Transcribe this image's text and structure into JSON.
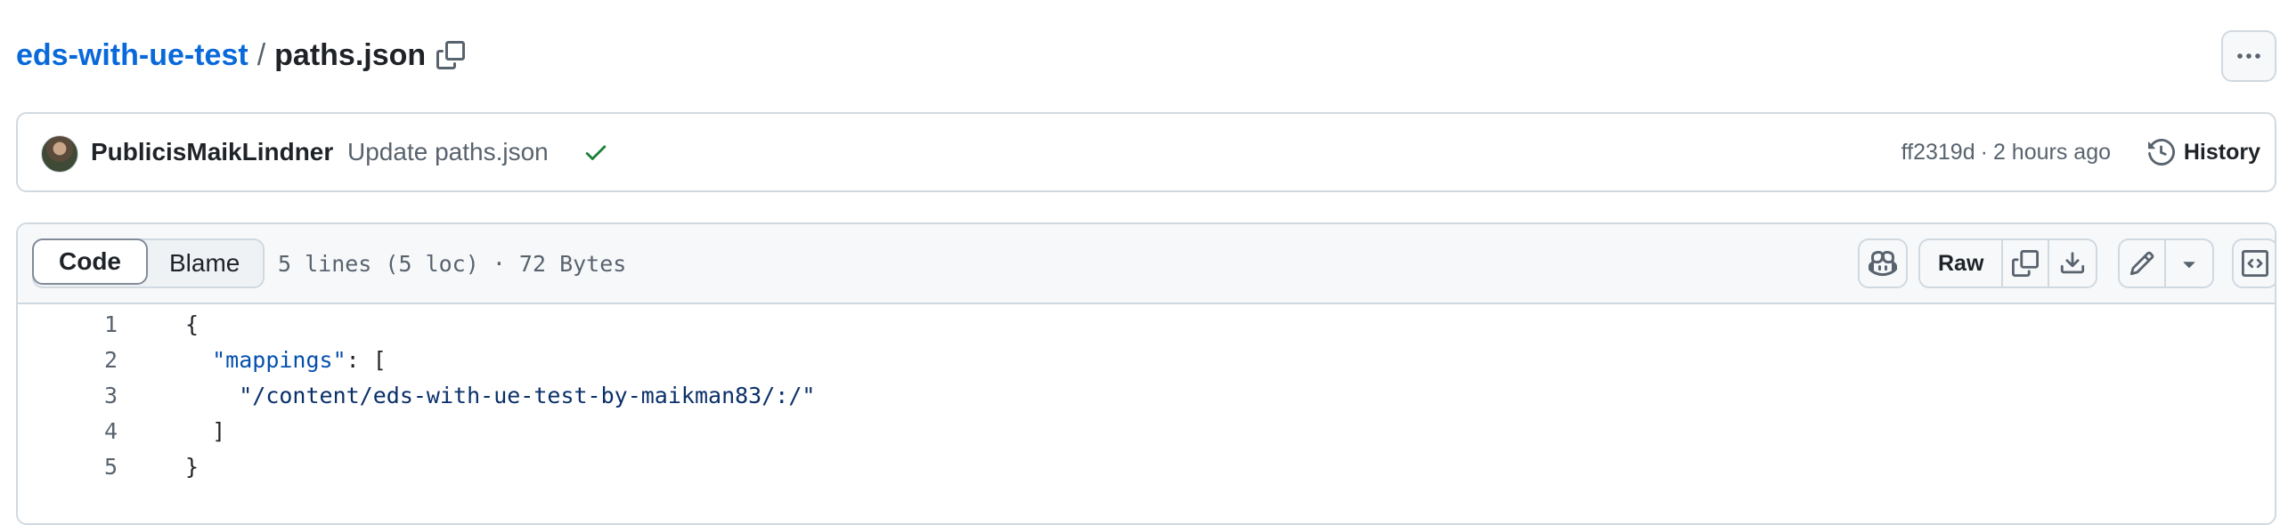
{
  "breadcrumb": {
    "repo": "eds-with-ue-test",
    "separator": "/",
    "file": "paths.json"
  },
  "icons": {
    "copy_path": "copy-icon",
    "more": "kebab-horizontal-icon",
    "check": "check-icon",
    "history": "history-icon",
    "copilot": "copilot-icon",
    "copy_raw": "copy-icon",
    "download": "download-icon",
    "edit": "pencil-icon",
    "dropdown": "triangle-down-icon",
    "symbols": "code-square-icon"
  },
  "commit": {
    "author": "PublicisMaikLindner",
    "message": "Update paths.json",
    "sha": "ff2319d",
    "separator": "·",
    "time": "2 hours ago",
    "history_label": "History"
  },
  "file_header": {
    "tabs": [
      {
        "label": "Code",
        "active": true
      },
      {
        "label": "Blame",
        "active": false
      }
    ],
    "info": "5 lines (5 loc) · 72 Bytes",
    "raw_label": "Raw"
  },
  "code": {
    "lines": [
      {
        "number": "1",
        "text": "{"
      },
      {
        "number": "2",
        "indent": "  ",
        "key": "\"mappings\"",
        "rest": ": ["
      },
      {
        "number": "3",
        "indent": "    ",
        "string": "\"/content/eds-with-ue-test-by-maikman83/:/\""
      },
      {
        "number": "4",
        "text": "  ]"
      },
      {
        "number": "5",
        "text": "}"
      }
    ]
  },
  "colors": {
    "link": "#0969da",
    "success": "#1a7f37",
    "muted": "#59636e",
    "border": "#d1d9e0",
    "code_key": "#0550ae",
    "code_string": "#0a3069"
  }
}
